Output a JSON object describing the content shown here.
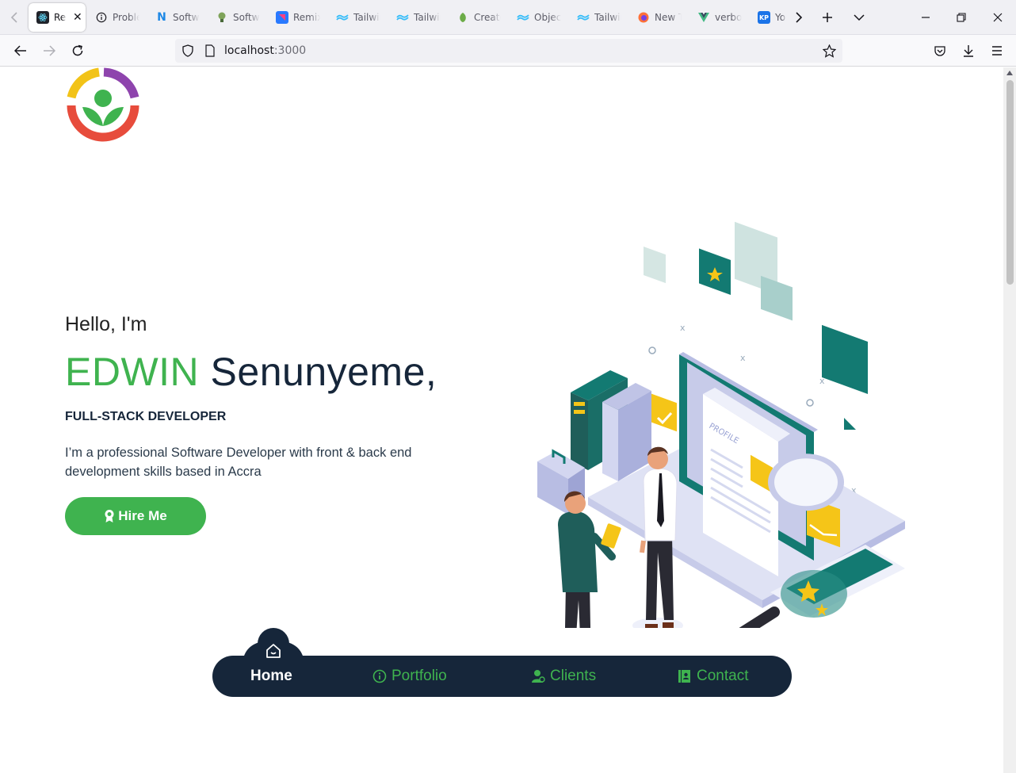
{
  "browser": {
    "tabs": [
      {
        "label": "React",
        "icon": "react-icon",
        "color": "#20232a"
      },
      {
        "label": "Problems",
        "icon": "info-icon",
        "color": "#ffffff"
      },
      {
        "label": "Software",
        "icon": "nestjs-icon",
        "color": "#1e88e5"
      },
      {
        "label": "Software",
        "icon": "bulb-icon",
        "color": "#4a7c59"
      },
      {
        "label": "Remix",
        "icon": "remix-icon",
        "color": "#2979ff"
      },
      {
        "label": "Tailwind",
        "icon": "tailwind-icon",
        "color": "#38bdf8"
      },
      {
        "label": "Tailwind",
        "icon": "tailwind-icon",
        "color": "#38bdf8"
      },
      {
        "label": "Create",
        "icon": "leaf-icon",
        "color": "#6cac48"
      },
      {
        "label": "Object",
        "icon": "tailwind-icon",
        "color": "#38bdf8"
      },
      {
        "label": "Tailwind",
        "icon": "tailwind-icon",
        "color": "#38bdf8"
      },
      {
        "label": "New Tab",
        "icon": "firefox-icon",
        "color": "#ff7139"
      },
      {
        "label": "verbose",
        "icon": "vue-icon",
        "color": "#42b883"
      },
      {
        "label": "You",
        "icon": "kp-icon",
        "color": "#1a73e8"
      }
    ],
    "active_tab_close": "✕",
    "url_host": "localhost",
    "url_port": ":3000"
  },
  "hero": {
    "greeting": "Hello, I'm",
    "first_name": "EDWIN",
    "last_name": " Senunyeme,",
    "role": "FULL-STACK DEVELOPER",
    "description": "I’m a professional Software Developer with front & back end development skills based in Accra",
    "hire_label": "Hire Me"
  },
  "bottom_nav": {
    "items": [
      {
        "label": "Home",
        "icon": "home-icon"
      },
      {
        "label": "Portfolio",
        "icon": "info-icon"
      },
      {
        "label": "Clients",
        "icon": "user-pin-icon"
      },
      {
        "label": "Contact",
        "icon": "contact-book-icon"
      }
    ]
  },
  "colors": {
    "accent_green": "#3fb34f",
    "navy": "#16263a"
  }
}
